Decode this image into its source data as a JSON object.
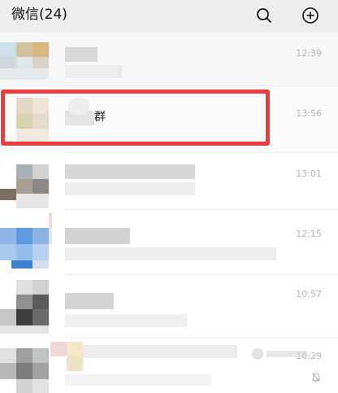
{
  "header": {
    "title": "微信(24)",
    "search_icon": "search-icon",
    "add_icon": "add-circle-icon"
  },
  "chats": [
    {
      "time": "12:39",
      "name": "",
      "preview": ""
    },
    {
      "time": "13:56",
      "name": "群",
      "preview": ""
    },
    {
      "time": "13:01",
      "name": "",
      "preview": ""
    },
    {
      "time": "12:15",
      "name": "",
      "preview": ""
    },
    {
      "time": "10:57",
      "name": "",
      "preview": ""
    },
    {
      "time": "10:29",
      "name": "",
      "preview": "",
      "muted": true
    }
  ],
  "colors": {
    "header_bg": "#ededed",
    "highlight": "#ee3b3b",
    "time_text": "#b3b3b3"
  }
}
